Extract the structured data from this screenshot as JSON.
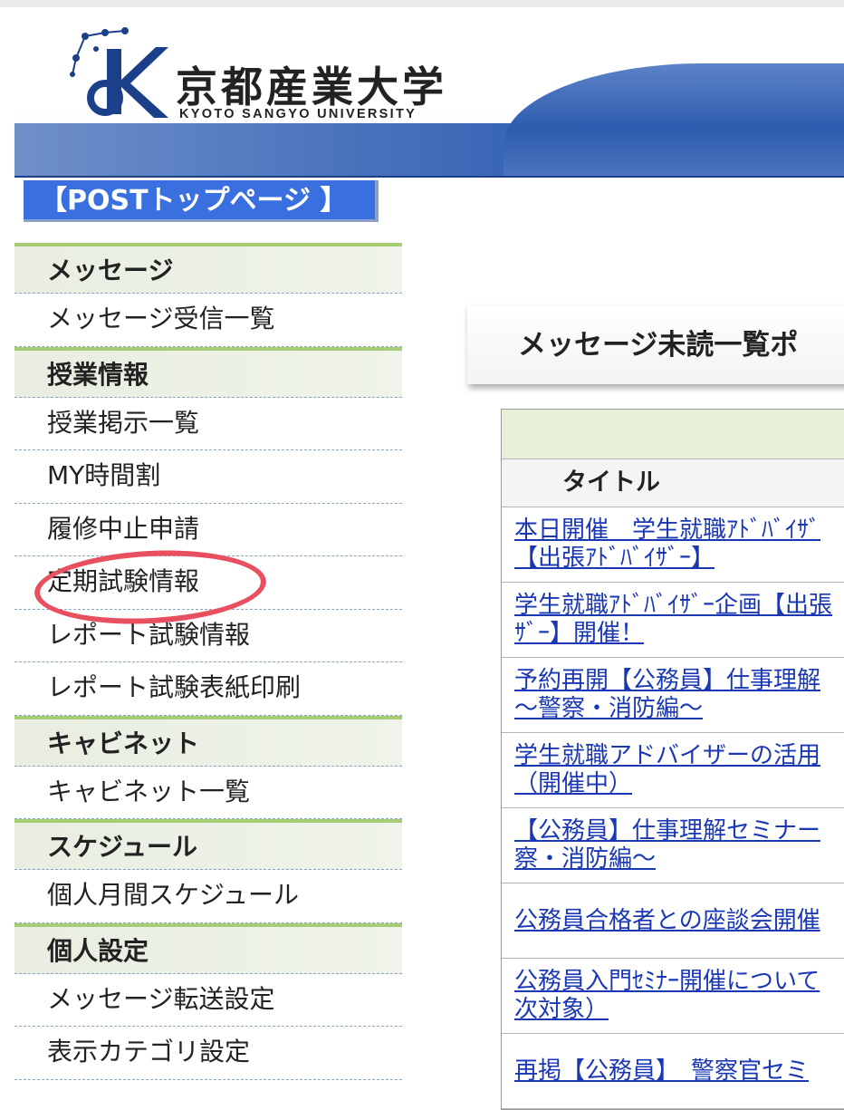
{
  "header": {
    "university_name": "京都産業大学",
    "university_name_en": "KYOTO SANGYO UNIVERSITY"
  },
  "post_top": {
    "label": "【POSTトップページ 】"
  },
  "sidebar": {
    "sections": [
      {
        "heading": "メッセージ",
        "items": [
          "メッセージ受信一覧"
        ]
      },
      {
        "heading": "授業情報",
        "items": [
          "授業掲示一覧",
          "MY時間割",
          "履修中止申請",
          "定期試験情報",
          "レポート試験情報",
          "レポート試験表紙印刷"
        ]
      },
      {
        "heading": "キャビネット",
        "items": [
          "キャビネット一覧"
        ]
      },
      {
        "heading": "スケジュール",
        "items": [
          "個人月間スケジュール"
        ]
      },
      {
        "heading": "個人設定",
        "items": [
          "メッセージ転送設定",
          "表示カテゴリ設定"
        ]
      }
    ]
  },
  "annotation": {
    "highlighted_item": "定期試験情報",
    "mark_color": "#e8505f"
  },
  "main": {
    "panel_title": "メッセージ未読一覧ポ",
    "table": {
      "column_title": "タイトル",
      "rows": [
        "本日開催　学生就職ｱﾄﾞﾊﾞｲｻﾞ\n【出張ｱﾄﾞﾊﾞｲｻﾞｰ】",
        "学生就職ｱﾄﾞﾊﾞｲｻﾞｰ企画【出張\nｻﾞｰ】開催！",
        "予約再開【公務員】仕事理解\n～警察・消防編～",
        "学生就職アドバイザーの活用\n（開催中）",
        "【公務員】仕事理解セミナー\n察・消防編～",
        "公務員合格者との座談会開催",
        "公務員入門ｾﾐﾅｰ開催について\n次対象）",
        "再掲【公務員】　警察官セミ"
      ]
    }
  },
  "colors": {
    "post_top_bg": "#3a6fe0",
    "section_accent": "#a6cc74",
    "link": "#1b38b4",
    "header_blue": "#2f5eb2"
  }
}
